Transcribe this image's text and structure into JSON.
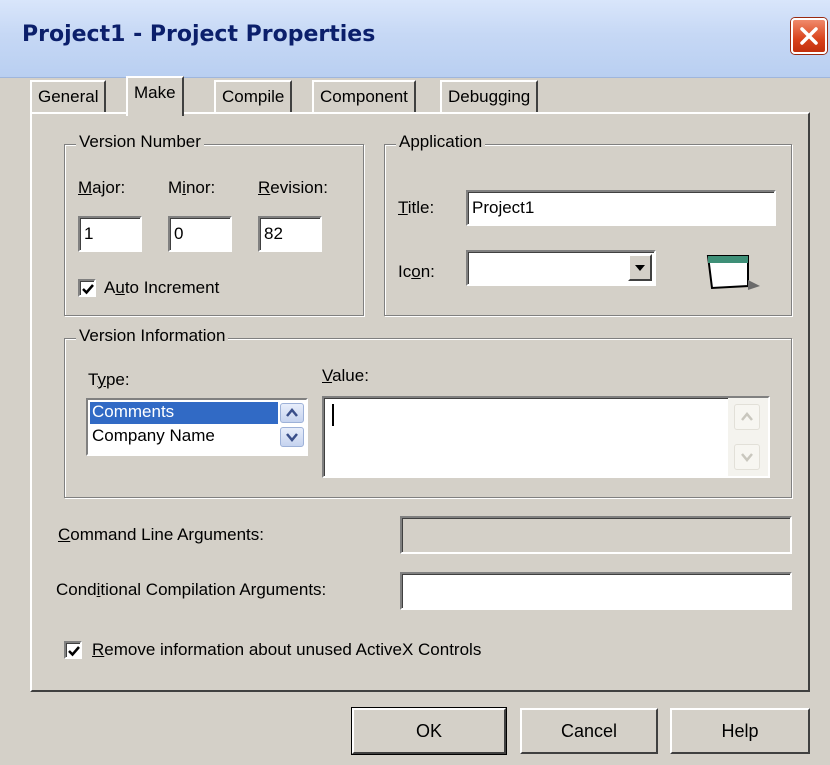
{
  "window": {
    "title": "Project1 - Project Properties"
  },
  "tabs": [
    {
      "label": "General"
    },
    {
      "label": "Make"
    },
    {
      "label": "Compile"
    },
    {
      "label": "Component"
    },
    {
      "label": "Debugging"
    }
  ],
  "version_number": {
    "group_label": "Version Number",
    "major_label": {
      "u": "M",
      "rest": "ajor:"
    },
    "minor_label": {
      "pre": "M",
      "u": "i",
      "rest": "nor:"
    },
    "revision_label": {
      "u": "R",
      "rest": "evision:"
    },
    "major_value": "1",
    "minor_value": "0",
    "revision_value": "82",
    "auto_increment": {
      "pre": "A",
      "u": "u",
      "rest": "to Increment",
      "checked": true
    }
  },
  "application": {
    "group_label": "Application",
    "title_label": {
      "u": "T",
      "rest": "itle:"
    },
    "title_value": "Project1",
    "icon_label": {
      "pre": "Ic",
      "u": "o",
      "rest": "n:"
    },
    "icon_value": ""
  },
  "version_information": {
    "group_label": "Version Information",
    "type_label": {
      "pre": "T",
      "u": "y",
      "rest": "pe:"
    },
    "value_label": {
      "u": "V",
      "rest": "alue:"
    },
    "types": [
      "Comments",
      "Company Name"
    ],
    "selected_type": "Comments",
    "value_text": ""
  },
  "command_line": {
    "label": {
      "u": "C",
      "rest": "ommand Line Arguments:"
    },
    "value": ""
  },
  "conditional_compilation": {
    "label": {
      "pre": "Cond",
      "u": "i",
      "rest": "tional Compilation Arguments:"
    },
    "value": ""
  },
  "remove_info": {
    "label": {
      "u": "R",
      "rest": "emove information about unused ActiveX Controls"
    },
    "checked": true
  },
  "buttons": {
    "ok": "OK",
    "cancel": "Cancel",
    "help": "Help"
  },
  "icons": {
    "close": "close-icon",
    "checkmark": "checkmark-icon",
    "combo_arrow": "chevron-down-icon",
    "form_icon": "form-window-icon",
    "spin_up": "chevron-up-icon",
    "spin_down": "chevron-down-icon"
  }
}
